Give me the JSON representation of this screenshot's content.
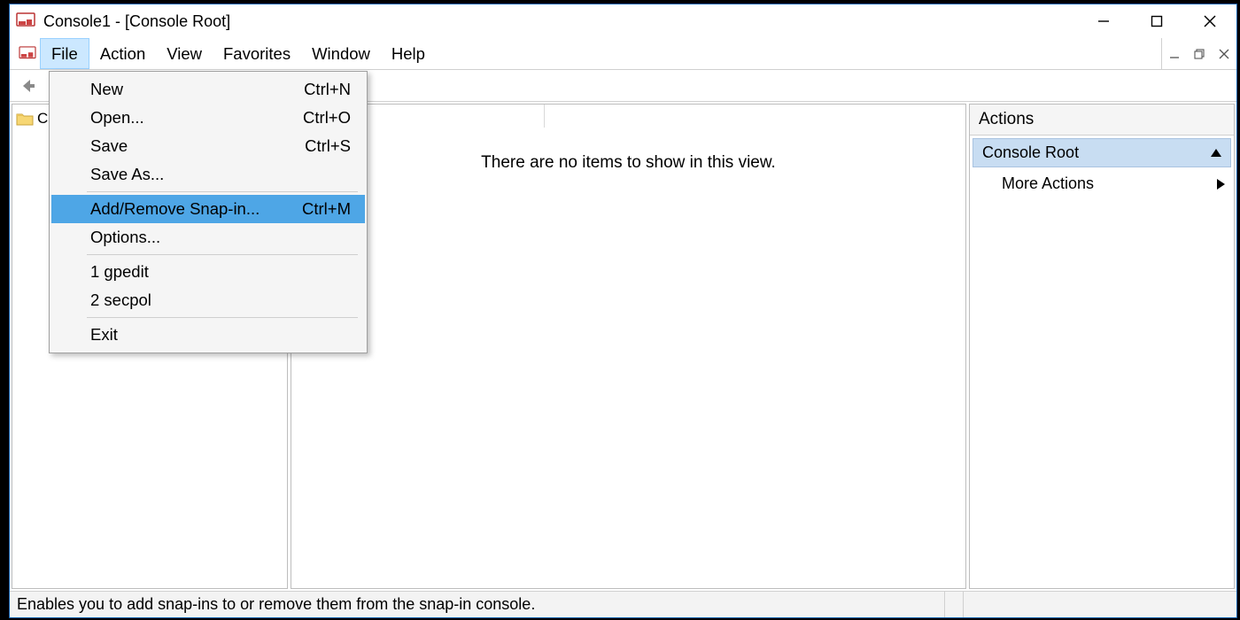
{
  "titlebar": {
    "title": "Console1 - [Console Root]"
  },
  "menubar": {
    "items": [
      "File",
      "Action",
      "View",
      "Favorites",
      "Window",
      "Help"
    ],
    "selected_index": 0
  },
  "file_menu": {
    "items": [
      {
        "label": "New",
        "shortcut": "Ctrl+N"
      },
      {
        "label": "Open...",
        "shortcut": "Ctrl+O"
      },
      {
        "label": "Save",
        "shortcut": "Ctrl+S"
      },
      {
        "label": "Save As...",
        "shortcut": ""
      }
    ],
    "items2": [
      {
        "label": "Add/Remove Snap-in...",
        "shortcut": "Ctrl+M",
        "highlighted": true
      },
      {
        "label": "Options...",
        "shortcut": ""
      }
    ],
    "items3": [
      {
        "label": "1 gpedit",
        "shortcut": ""
      },
      {
        "label": "2 secpol",
        "shortcut": ""
      }
    ],
    "items4": [
      {
        "label": "Exit",
        "shortcut": ""
      }
    ]
  },
  "tree": {
    "root_label": "Console Root"
  },
  "content": {
    "empty_message": "There are no items to show in this view."
  },
  "actions": {
    "header": "Actions",
    "section": "Console Root",
    "more": "More Actions"
  },
  "statusbar": {
    "text": "Enables you to add snap-ins to or remove them from the snap-in console."
  }
}
